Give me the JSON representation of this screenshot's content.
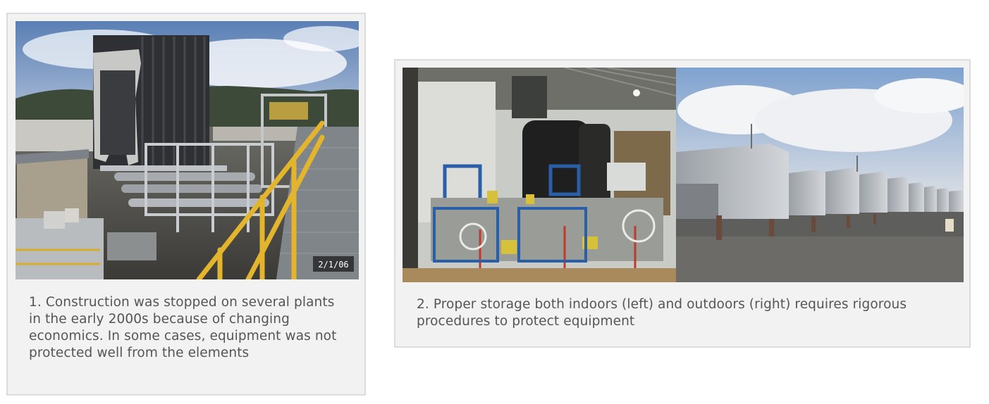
{
  "figures": [
    {
      "caption": "1. Construction was stopped on several plants in the early 2000s because of changing economics. In some cases, equipment was not protected well from the elements",
      "photo": {
        "subject": "construction-site-photo",
        "date_stamp": "2/1/06"
      }
    },
    {
      "caption": "2. Proper storage both indoors (left) and outdoors (right) requires rigorous procedures to protect equipment",
      "photo": {
        "subject": "indoor-outdoor-storage-photo"
      }
    }
  ],
  "colors": {
    "figure_background": "#f2f2f2",
    "figure_border": "#dcdcdc",
    "caption_text": "#555555"
  }
}
